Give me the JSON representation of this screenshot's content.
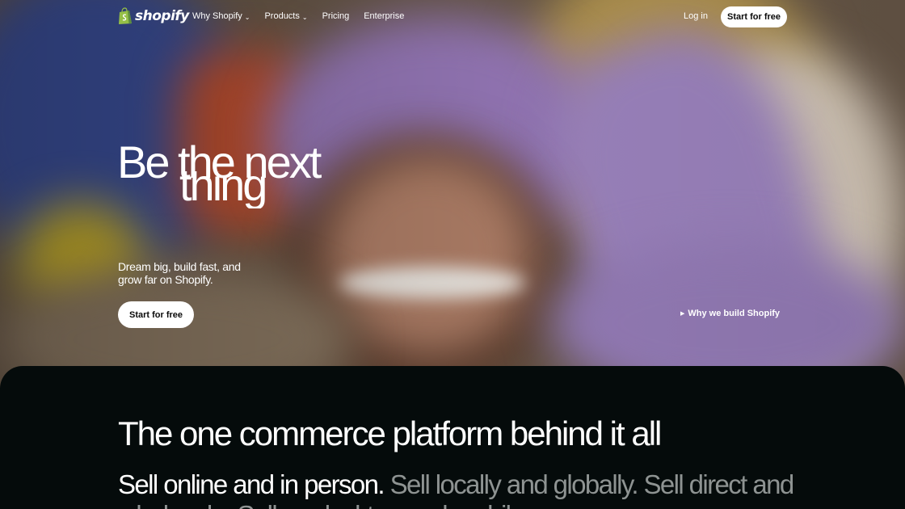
{
  "brand": {
    "name": "shopify"
  },
  "nav": {
    "items": [
      {
        "label": "Why Shopify",
        "has_dropdown": true
      },
      {
        "label": "Products",
        "has_dropdown": true
      },
      {
        "label": "Pricing",
        "has_dropdown": false
      },
      {
        "label": "Enterprise",
        "has_dropdown": false
      }
    ],
    "login_label": "Log in",
    "cta_label": "Start for free"
  },
  "hero": {
    "title_line1": "Be the next",
    "title_line2": "thing",
    "subtitle": "Dream big, build fast, and grow far on Shopify.",
    "cta_label": "Start for free",
    "video_link_label": "Why we build Shopify"
  },
  "platform": {
    "title": "The one commerce platform behind it all",
    "sub_highlight": "Sell online and in person.",
    "sub_rest": "Sell locally and globally. Sell direct and",
    "sub_line2": "wholesale. Sell on desktop and mobile."
  },
  "colors": {
    "brand_green": "#95bf47",
    "dark_bg": "#050b0b",
    "muted_text": "#8e9392"
  }
}
